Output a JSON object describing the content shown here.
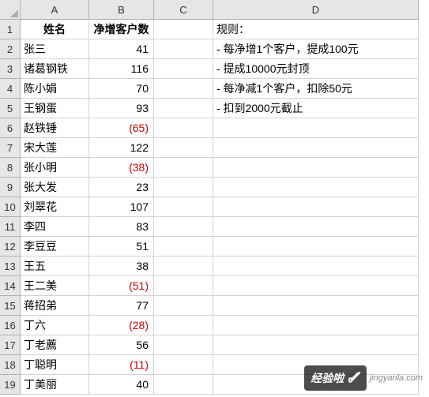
{
  "columns": [
    "A",
    "B",
    "C",
    "D"
  ],
  "headers": {
    "name": "姓名",
    "count": "净增客户数"
  },
  "rules_title": "规则：",
  "rules": [
    "- 每净增1个客户，提成100元",
    "- 提成10000元封顶",
    "- 每净减1个客户，扣除50元",
    "- 扣到2000元截止"
  ],
  "rows": [
    {
      "name": "张三",
      "value": 41
    },
    {
      "name": "诸葛钢铁",
      "value": 116
    },
    {
      "name": "陈小娟",
      "value": 70
    },
    {
      "name": "王钢蛋",
      "value": 93
    },
    {
      "name": "赵铁锤",
      "value": -65
    },
    {
      "name": "宋大莲",
      "value": 122
    },
    {
      "name": "张小明",
      "value": -38
    },
    {
      "name": "张大发",
      "value": 23
    },
    {
      "name": "刘翠花",
      "value": 107
    },
    {
      "name": "李四",
      "value": 83
    },
    {
      "name": "李豆豆",
      "value": 51
    },
    {
      "name": "王五",
      "value": 38
    },
    {
      "name": "王二美",
      "value": -51
    },
    {
      "name": "蒋招弟",
      "value": 77
    },
    {
      "name": "丁六",
      "value": -28
    },
    {
      "name": "丁老薦",
      "value": 56
    },
    {
      "name": "丁聪明",
      "value": -11
    },
    {
      "name": "丁美丽",
      "value": 40
    }
  ],
  "watermark": {
    "text": "经验啦",
    "url": "jingyanla.com"
  },
  "chart_data": {
    "type": "table",
    "title": "净增客户数",
    "columns": [
      "姓名",
      "净增客户数"
    ],
    "data": [
      [
        "张三",
        41
      ],
      [
        "诸葛钢铁",
        116
      ],
      [
        "陈小娟",
        70
      ],
      [
        "王钢蛋",
        93
      ],
      [
        "赵铁锤",
        -65
      ],
      [
        "宋大莲",
        122
      ],
      [
        "张小明",
        -38
      ],
      [
        "张大发",
        23
      ],
      [
        "刘翠花",
        107
      ],
      [
        "李四",
        83
      ],
      [
        "李豆豆",
        51
      ],
      [
        "王五",
        38
      ],
      [
        "王二美",
        -51
      ],
      [
        "蒋招弟",
        77
      ],
      [
        "丁六",
        -28
      ],
      [
        "丁老薦",
        56
      ],
      [
        "丁聪明",
        -11
      ],
      [
        "丁美丽",
        40
      ]
    ],
    "rules": [
      "每净增1个客户，提成100元",
      "提成10000元封顶",
      "每净减1个客户，扣除50元",
      "扣到2000元截止"
    ]
  }
}
